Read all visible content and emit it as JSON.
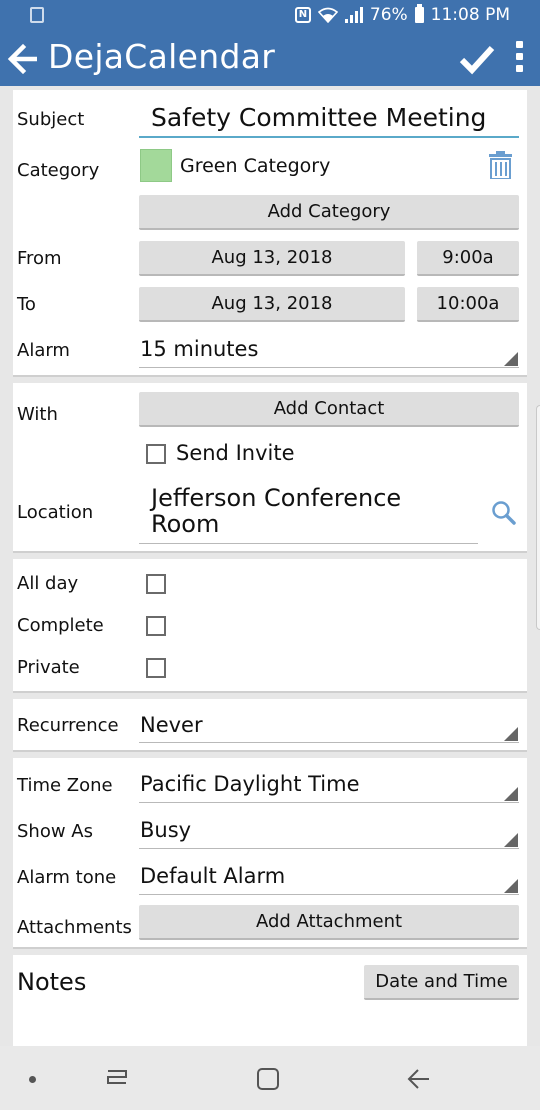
{
  "status_bar": {
    "battery": "76%",
    "time": "11:08 PM",
    "nfc_label": "N"
  },
  "app_bar": {
    "title": "DejaCalendar"
  },
  "form": {
    "subject_label": "Subject",
    "subject_value": "Safety Committee Meeting",
    "category_label": "Category",
    "category_value": "Green Category",
    "category_color": "#a3d99a",
    "add_category": "Add Category",
    "from_label": "From",
    "from_date": "Aug 13, 2018",
    "from_time": "9:00a",
    "to_label": "To",
    "to_date": "Aug 13, 2018",
    "to_time": "10:00a",
    "alarm_label": "Alarm",
    "alarm_value": "15 minutes",
    "with_label": "With",
    "add_contact": "Add Contact",
    "send_invite": "Send Invite",
    "location_label": "Location",
    "location_line1": "Jefferson Conference",
    "location_line2": "Room",
    "all_day_label": "All day",
    "complete_label": "Complete",
    "private_label": "Private",
    "recurrence_label": "Recurrence",
    "recurrence_value": "Never",
    "timezone_label": "Time Zone",
    "timezone_value": "Pacific Daylight Time",
    "show_as_label": "Show As",
    "show_as_value": "Busy",
    "alarm_tone_label": "Alarm tone",
    "alarm_tone_value": "Default Alarm",
    "attachments_label": "Attachments",
    "add_attachment": "Add Attachment",
    "notes_label": "Notes",
    "date_and_time": "Date and Time"
  },
  "colors": {
    "app_bar": "#3f72ae",
    "accent_underline": "#5aa9c9",
    "icon_blue": "#6a9ed0"
  }
}
